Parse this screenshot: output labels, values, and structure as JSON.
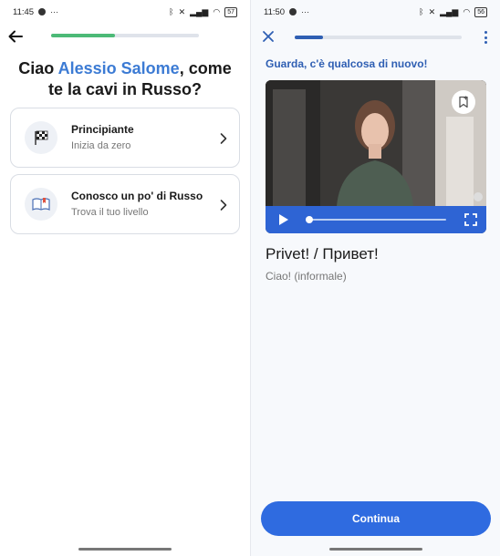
{
  "left_screen": {
    "status": {
      "time": "11:45",
      "battery": "57"
    },
    "progress": {
      "fraction": 0.43
    },
    "greeting": {
      "prefix": "Ciao ",
      "name": "Alessio Salome",
      "suffix": ", come te la cavi in Russo?"
    },
    "levels": [
      {
        "title": "Principiante",
        "subtitle": "Inizia da zero",
        "icon": "checkered-flag-icon"
      },
      {
        "title": "Conosco un po' di Russo",
        "subtitle": "Trova il tuo livello",
        "icon": "open-book-icon"
      }
    ]
  },
  "right_screen": {
    "status": {
      "time": "11:50",
      "battery": "56"
    },
    "progress": {
      "fraction": 0.17
    },
    "heading": "Guarda, c'è qualcosa di nuovo!",
    "video": {
      "playback_fraction": 0.0
    },
    "phrase": "Privet! / Привет!",
    "translation": "Ciao! (informale)",
    "continue_label": "Continua"
  },
  "colors": {
    "brand_blue": "#2f6be0",
    "heading_blue": "#2f5fb3",
    "name_blue": "#3c7bd4",
    "progress_green": "#4cba77"
  }
}
